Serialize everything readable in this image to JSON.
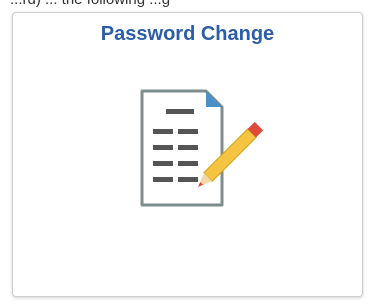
{
  "page": {
    "partial_text_top": "...rd) ... the following ...g"
  },
  "tile": {
    "title": "Password Change",
    "icon": "document-edit-icon"
  },
  "colors": {
    "title": "#2b5da8",
    "document_outline": "#7f8c8d",
    "document_lines": "#555555",
    "fold_corner": "#4a90c9",
    "pencil_body": "#f5c542",
    "pencil_tip_eraser": "#e04a3b"
  }
}
